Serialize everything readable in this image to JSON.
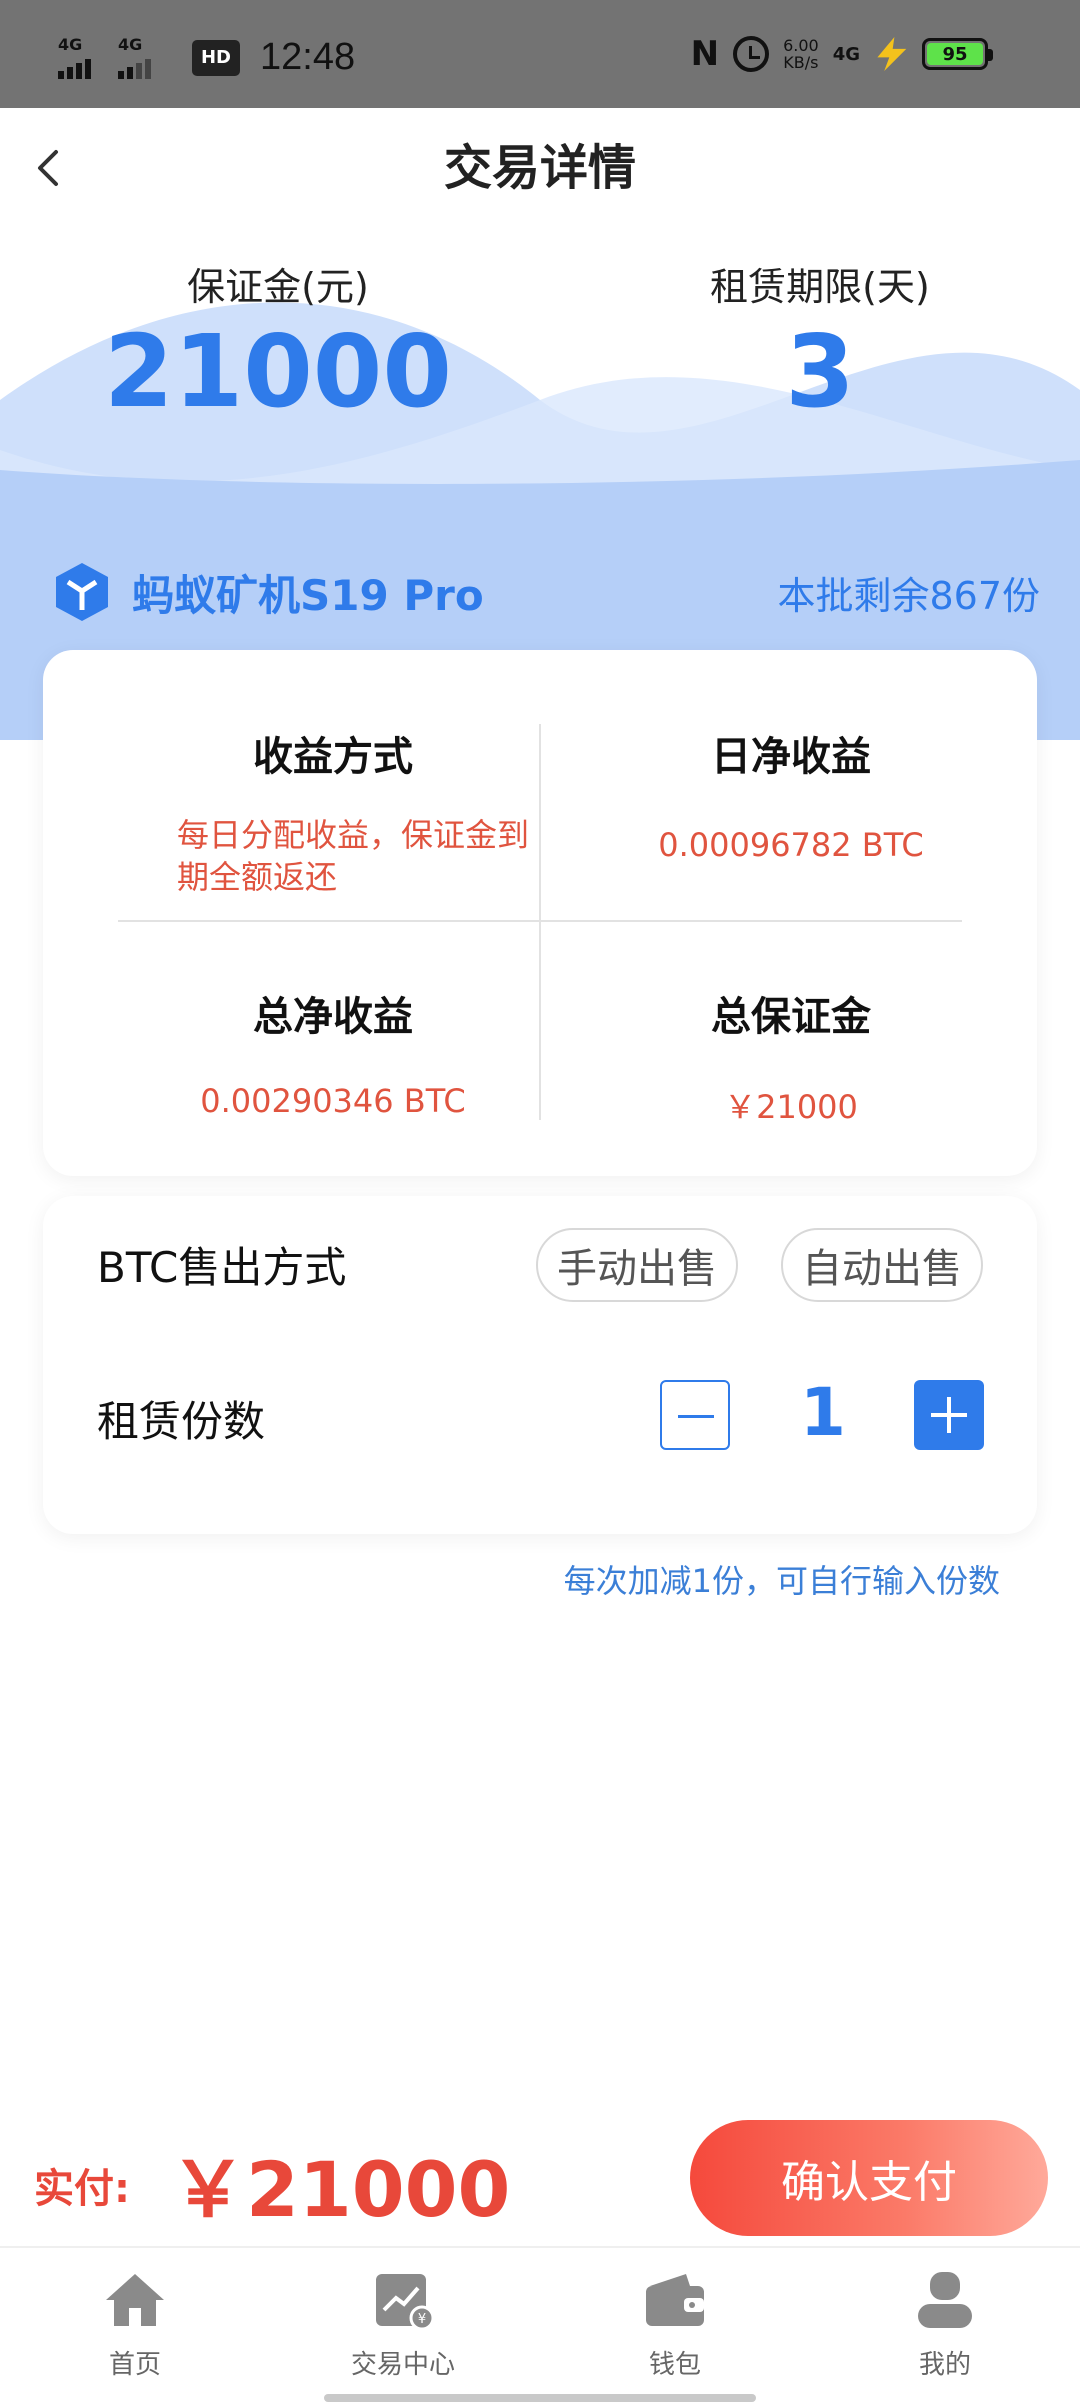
{
  "status_bar": {
    "network_1": "4G",
    "network_2": "4G",
    "hd_badge": "HD",
    "time": "12:48",
    "speed_value": "6.00",
    "speed_unit": "KB/s",
    "network_right": "4G",
    "battery": "95"
  },
  "header": {
    "title": "交易详情"
  },
  "hero": {
    "deposit_label": "保证金(元)",
    "deposit_value": "21000",
    "term_label": "租赁期限(天)",
    "term_value": "3"
  },
  "product": {
    "name": "蚂蚁矿机S19 Pro",
    "remaining": "本批剩余867份"
  },
  "info": {
    "income_method_label": "收益方式",
    "income_method_value": "每日分配收益，保证金到期全额返还",
    "daily_income_label": "日净收益",
    "daily_income_value": "0.00096782 BTC",
    "total_income_label": "总净收益",
    "total_income_value": "0.00290346 BTC",
    "total_deposit_label": "总保证金",
    "total_deposit_value": "￥21000"
  },
  "options": {
    "sell_label": "BTC售出方式",
    "manual_sell": "手动出售",
    "auto_sell": "自动出售",
    "quantity_label": "租赁份数",
    "quantity_value": "1",
    "hint": "每次加减1份，可自行输入份数"
  },
  "payment": {
    "label": "实付:",
    "amount": "￥21000",
    "confirm": "确认支付"
  },
  "tabs": [
    {
      "label": "首页",
      "icon": "home-icon"
    },
    {
      "label": "交易中心",
      "icon": "trade-chart-icon"
    },
    {
      "label": "钱包",
      "icon": "wallet-icon"
    },
    {
      "label": "我的",
      "icon": "user-icon"
    }
  ],
  "colors": {
    "primary_blue": "#2f7bea",
    "accent_red": "#e8483a",
    "hero_light_blue": "#cfe0fb",
    "hero_blue": "#b3cef8"
  }
}
